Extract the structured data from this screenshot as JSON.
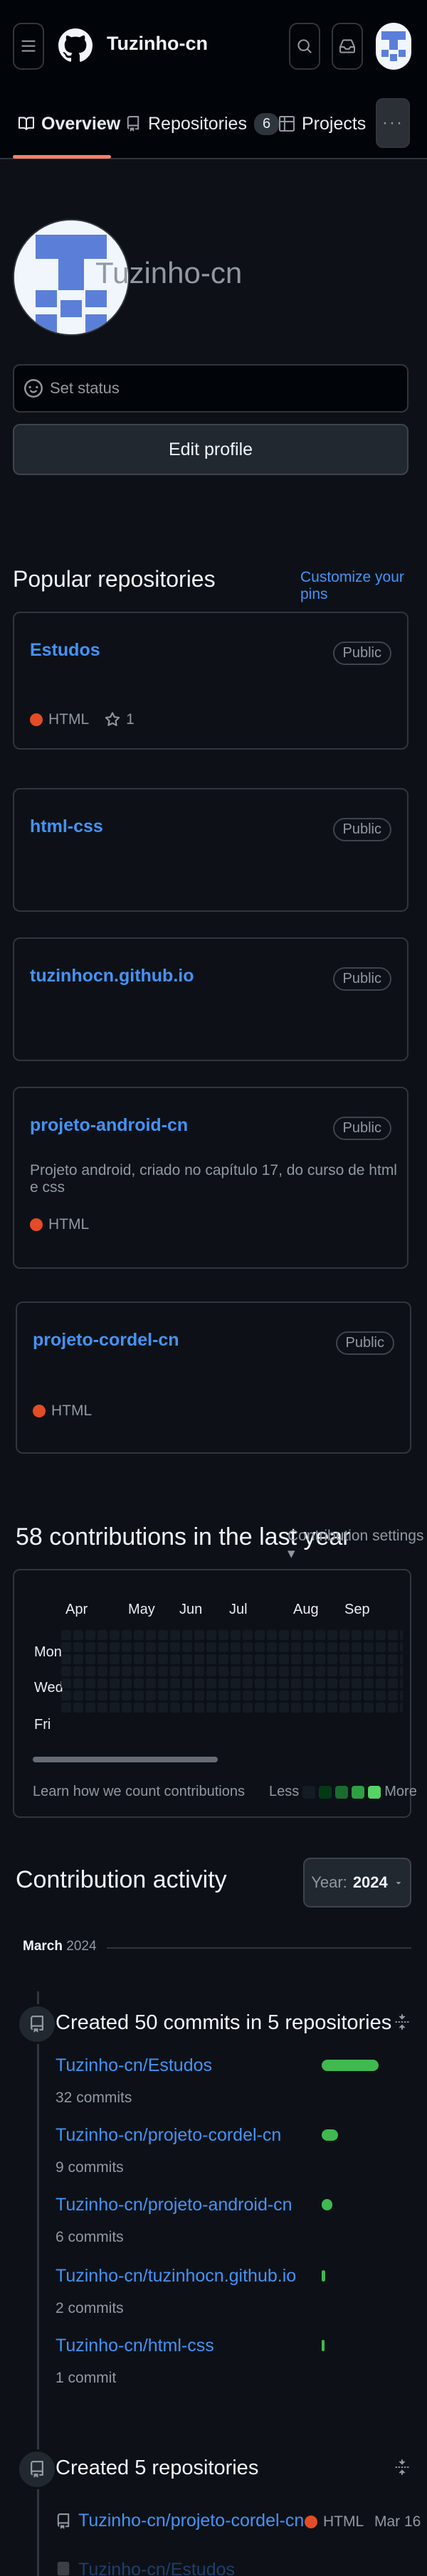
{
  "header": {
    "username": "Tuzinho-cn"
  },
  "tabs": [
    {
      "label": "Overview",
      "icon": "book-icon"
    },
    {
      "label": "Repositories",
      "icon": "repo-icon",
      "count": "6"
    },
    {
      "label": "Projects",
      "icon": "table-icon"
    }
  ],
  "more_label": "···",
  "profile": {
    "display_name": "Tuzinho-cn",
    "set_status": "Set status",
    "edit_profile": "Edit profile"
  },
  "popular": {
    "title": "Popular repositories",
    "customize": "Customize your pins",
    "repos": [
      {
        "name": "Estudos",
        "visibility": "Public",
        "description": "",
        "language": "HTML",
        "stars": "1"
      },
      {
        "name": "html-css",
        "visibility": "Public",
        "description": "",
        "language": "",
        "stars": ""
      },
      {
        "name": "tuzinhocn.github.io",
        "visibility": "Public",
        "description": "",
        "language": "",
        "stars": ""
      },
      {
        "name": "projeto-android-cn",
        "visibility": "Public",
        "description": "Projeto android, criado no capítulo 17, do curso de html e css",
        "language": "HTML",
        "stars": ""
      },
      {
        "name": "projeto-cordel-cn",
        "visibility": "Public",
        "description": "",
        "language": "HTML",
        "stars": ""
      }
    ]
  },
  "contributions": {
    "title": "58 contributions in the last year",
    "settings": "Contribution settings ▾",
    "months": [
      "Apr",
      "May",
      "Jun",
      "Jul",
      "Aug",
      "Sep"
    ],
    "days": [
      "Mon",
      "Wed",
      "Fri"
    ],
    "learn": "Learn how we count contributions",
    "less": "Less",
    "more": "More",
    "colors": {
      "empty": "#151b23",
      "l1": "#033a16",
      "l2": "#196c2e",
      "l3": "#2ea043",
      "l4": "#56d364"
    }
  },
  "activity": {
    "title": "Contribution activity",
    "year_label": "Year:",
    "year": "2024",
    "month": "March",
    "month_year": "2024",
    "commits_title": "Created 50 commits in 5 repositories",
    "commits": [
      {
        "repo": "Tuzinho-cn/Estudos",
        "count": "32 commits",
        "share": 0.64
      },
      {
        "repo": "Tuzinho-cn/projeto-cordel-cn",
        "count": "9 commits",
        "share": 0.18
      },
      {
        "repo": "Tuzinho-cn/projeto-android-cn",
        "count": "6 commits",
        "share": 0.12
      },
      {
        "repo": "Tuzinho-cn/tuzinhocn.github.io",
        "count": "2 commits",
        "share": 0.04
      },
      {
        "repo": "Tuzinho-cn/html-css",
        "count": "1 commit",
        "share": 0.02
      }
    ],
    "repos_title": "Created 5 repositories",
    "created": {
      "repo": "Tuzinho-cn/projeto-cordel-cn",
      "language": "HTML",
      "date": "Mar 16"
    },
    "created_next": "Tuzinho-cn/Estudos"
  }
}
